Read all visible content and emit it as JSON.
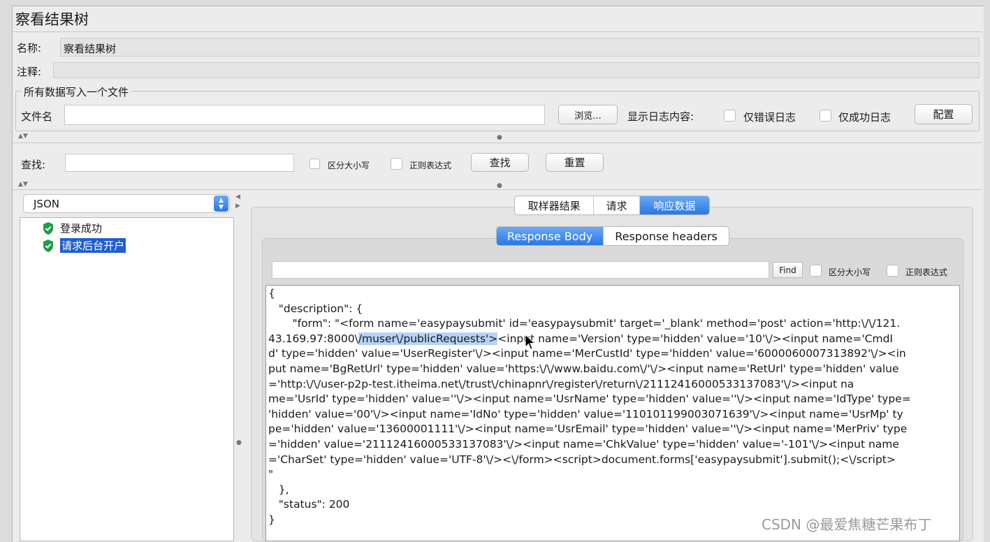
{
  "window": {
    "title": "察看结果树"
  },
  "form": {
    "name_label": "名称:",
    "name_value": "察看结果树",
    "comment_label": "注释:",
    "comment_value": ""
  },
  "file_group": {
    "legend": "所有数据写入一个文件",
    "filename_label": "文件名",
    "filename_value": "",
    "browse_button": "浏览...",
    "log_label": "显示日志内容:",
    "errors_only_label": "仅错误日志",
    "success_only_label": "仅成功日志",
    "config_button": "配置"
  },
  "search": {
    "label": "查找:",
    "value": "",
    "case_label": "区分大小写",
    "regex_label": "正则表达式",
    "find_button": "查找",
    "reset_button": "重置"
  },
  "renderer": {
    "selected": "JSON"
  },
  "tree": {
    "items": [
      {
        "label": "登录成功",
        "status": "success"
      },
      {
        "label": "请求后台开户",
        "status": "success",
        "selected": true
      }
    ]
  },
  "result_tabs": [
    {
      "label": "取样器结果",
      "active": false
    },
    {
      "label": "请求",
      "active": false
    },
    {
      "label": "响应数据",
      "active": true
    }
  ],
  "body_tabs": [
    {
      "label": "Response Body",
      "active": true
    },
    {
      "label": "Response headers",
      "active": false
    }
  ],
  "body_find": {
    "value": "",
    "find_button": "Find",
    "case_label": "区分大小写",
    "regex_label": "正则表达式"
  },
  "response_lines": [
    {
      "text": "{"
    },
    {
      "text": "   \"description\": {"
    },
    {
      "text": "       \"form\": \"<form name='easypaysubmit' id='easypaysubmit' target='_blank' method='post' action='http:\\/\\/121."
    },
    {
      "pre": "43.169.97:8000\\",
      "hl": "/muser\\/publicRequests'>",
      "post": "<input name='Version' type='hidden' value='10'\\/><input name='CmdI"
    },
    {
      "text": "d' type='hidden' value='UserRegister'\\/><input name='MerCustId' type='hidden' value='6000060007313892'\\/><in"
    },
    {
      "text": "put name='BgRetUrl' type='hidden' value='https:\\/\\/www.baidu.com\\/'\\/><input name='RetUrl' type='hidden' value"
    },
    {
      "text": "='http:\\/\\/user-p2p-test.itheima.net\\/trust\\/chinapnr\\/register\\/return\\/21112416000533137083'\\/><input na"
    },
    {
      "text": "me='UsrId' type='hidden' value=''\\/><input name='UsrName' type='hidden' value=''\\/><input name='IdType' type="
    },
    {
      "text": "'hidden' value='00'\\/><input name='IdNo' type='hidden' value='110101199003071639'\\/><input name='UsrMp' ty"
    },
    {
      "text": "pe='hidden' value='13600001111'\\/><input name='UsrEmail' type='hidden' value=''\\/><input name='MerPriv' type"
    },
    {
      "text": "='hidden' value='21112416000533137083'\\/><input name='ChkValue' type='hidden' value='-101'\\/><input name"
    },
    {
      "text": "='CharSet' type='hidden' value='UTF-8'\\/><\\/form><script>document.forms['easypaysubmit'].submit();<\\/script>"
    },
    {
      "text": "\""
    },
    {
      "text": "   },"
    },
    {
      "text": "   \"status\": 200"
    },
    {
      "text": "}"
    }
  ],
  "watermark": "CSDN @最爱焦糖芒果布丁",
  "colors": {
    "accent": "#2a78e4",
    "success": "#1f9d4a",
    "selection": "#1f5fd0"
  }
}
